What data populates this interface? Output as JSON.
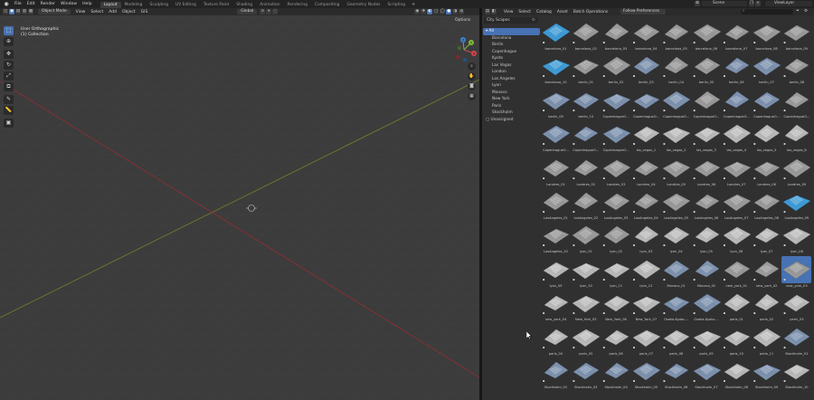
{
  "topbar": {
    "menus": [
      "File",
      "Edit",
      "Render",
      "Window",
      "Help"
    ],
    "workspaces": [
      "Layout",
      "Modeling",
      "Sculpting",
      "UV Editing",
      "Texture Paint",
      "Shading",
      "Animation",
      "Rendering",
      "Compositing",
      "Geometry Nodes",
      "Scripting"
    ],
    "active_workspace": "Layout",
    "add_tab": "+",
    "scene": "Scene",
    "view_layer": "ViewLayer"
  },
  "viewport": {
    "mode": "Object Mode",
    "menus": [
      "View",
      "Select",
      "Add",
      "Object",
      "GIS"
    ],
    "orientation": "Global",
    "info_line1": "User Orthographic",
    "info_line2": "(1) Collection",
    "options_label": "Options",
    "gizmo": {
      "x": "X",
      "y": "Y",
      "z": "Z"
    },
    "colors": {
      "bg": "#3c3c3c",
      "grid": "#444444",
      "x_axis": "#8a2f33",
      "y_axis": "#6f7a2c",
      "accent": "#4772b3"
    }
  },
  "asset_browser": {
    "menus": [
      "View",
      "Select",
      "Catalog",
      "Asset",
      "Batch Operations"
    ],
    "library": "City Scapes",
    "import_method": "Follow Preferences",
    "search_placeholder": "",
    "catalogs": [
      "All",
      "Barcelona",
      "Berlin",
      "Copenhague",
      "Kyoto",
      "Las Vegas",
      "London",
      "Los Angeles",
      "Lyon",
      "Monaco",
      "New York",
      "Paris",
      "Stockholm",
      "Unassigned"
    ],
    "assets": [
      {
        "label": "barcelona_01",
        "tone": "blue"
      },
      {
        "label": "barcelona_02",
        "tone": "gray"
      },
      {
        "label": "barcelona_03",
        "tone": "gray"
      },
      {
        "label": "barcelona_04",
        "tone": "gray"
      },
      {
        "label": "barcelona_05",
        "tone": "gray"
      },
      {
        "label": "barcelona_06",
        "tone": "gray"
      },
      {
        "label": "barcelona_07",
        "tone": "gray"
      },
      {
        "label": "barcelona_08",
        "tone": "gray"
      },
      {
        "label": "barcelona_09",
        "tone": "gray"
      },
      {
        "label": "barcelona_10",
        "tone": "blue"
      },
      {
        "label": "berlin_01",
        "tone": "gray"
      },
      {
        "label": "berlin_02",
        "tone": "gray"
      },
      {
        "label": "berlin_03",
        "tone": "bluegray"
      },
      {
        "label": "berlin_04",
        "tone": "gray"
      },
      {
        "label": "berlin_05",
        "tone": "gray"
      },
      {
        "label": "berlin_06",
        "tone": "bluegray"
      },
      {
        "label": "berlin_07",
        "tone": "bluegray"
      },
      {
        "label": "berlin_08",
        "tone": "gray"
      },
      {
        "label": "berlin_09",
        "tone": "bluegray"
      },
      {
        "label": "berlin_10",
        "tone": "bluegray"
      },
      {
        "label": "CopenhagueO...",
        "tone": "bluegray"
      },
      {
        "label": "CopenhagueO...",
        "tone": "bluegray"
      },
      {
        "label": "CopenhagueO...",
        "tone": "bluegray"
      },
      {
        "label": "CopenhagueO...",
        "tone": "gray"
      },
      {
        "label": "CopenhagueO...",
        "tone": "bluegray"
      },
      {
        "label": "CopenhagueO...",
        "tone": "bluegray"
      },
      {
        "label": "CopenhagueO...",
        "tone": "gray"
      },
      {
        "label": "CopenhagueO...",
        "tone": "bluegray"
      },
      {
        "label": "CopenhagueO...",
        "tone": "bluegray"
      },
      {
        "label": "CopenhagueO...",
        "tone": "bluegray"
      },
      {
        "label": "las_vegas_1",
        "tone": "light"
      },
      {
        "label": "las_vegas_2",
        "tone": "light"
      },
      {
        "label": "las_vegas_3",
        "tone": "light"
      },
      {
        "label": "las_vegas_4",
        "tone": "light"
      },
      {
        "label": "las_vegas_5",
        "tone": "light"
      },
      {
        "label": "las_vegas_6",
        "tone": "light"
      },
      {
        "label": "Londres_01",
        "tone": "gray"
      },
      {
        "label": "Londres_02",
        "tone": "gray"
      },
      {
        "label": "Londres_03",
        "tone": "gray"
      },
      {
        "label": "Londres_04",
        "tone": "gray"
      },
      {
        "label": "Londres_05",
        "tone": "gray"
      },
      {
        "label": "Londres_06",
        "tone": "gray"
      },
      {
        "label": "Londres_07",
        "tone": "gray"
      },
      {
        "label": "Londres_08",
        "tone": "gray"
      },
      {
        "label": "Londres_09",
        "tone": "gray"
      },
      {
        "label": "LosAngeles_01",
        "tone": "gray"
      },
      {
        "label": "LosAngeles_02",
        "tone": "gray"
      },
      {
        "label": "LosAngeles_03",
        "tone": "gray"
      },
      {
        "label": "LosAngeles_04",
        "tone": "gray"
      },
      {
        "label": "LosAngeles_05",
        "tone": "gray"
      },
      {
        "label": "LosAngeles_06",
        "tone": "gray"
      },
      {
        "label": "LosAngeles_07",
        "tone": "gray"
      },
      {
        "label": "LosAngeles_08",
        "tone": "gray"
      },
      {
        "label": "LosAngeles_09",
        "tone": "blue"
      },
      {
        "label": "LosAngeles_10",
        "tone": "gray"
      },
      {
        "label": "lyon_01",
        "tone": "gray"
      },
      {
        "label": "lyon_02",
        "tone": "gray"
      },
      {
        "label": "lyon_03",
        "tone": "light"
      },
      {
        "label": "lyon_04",
        "tone": "light"
      },
      {
        "label": "lyon_05",
        "tone": "light"
      },
      {
        "label": "lyon_06",
        "tone": "light"
      },
      {
        "label": "lyon_07",
        "tone": "light"
      },
      {
        "label": "lyon_08",
        "tone": "light"
      },
      {
        "label": "lyon_09",
        "tone": "light"
      },
      {
        "label": "lyon_10",
        "tone": "light"
      },
      {
        "label": "lyon_11",
        "tone": "light"
      },
      {
        "label": "lyon_12",
        "tone": "light"
      },
      {
        "label": "Monaco_01",
        "tone": "bluegray"
      },
      {
        "label": "Monaco_02",
        "tone": "bluegray"
      },
      {
        "label": "new_york_01",
        "tone": "gray"
      },
      {
        "label": "new_york_02",
        "tone": "gray"
      },
      {
        "label": "new_york_03",
        "tone": "gray"
      },
      {
        "label": "new_york_04",
        "tone": "light"
      },
      {
        "label": "New_York_05",
        "tone": "light"
      },
      {
        "label": "New_York_06",
        "tone": "light"
      },
      {
        "label": "New_York_07",
        "tone": "light"
      },
      {
        "label": "Osaka-Kyoto-...",
        "tone": "bluegray"
      },
      {
        "label": "Osaka-Kyoto-...",
        "tone": "bluegray"
      },
      {
        "label": "paris_01",
        "tone": "light"
      },
      {
        "label": "paris_02",
        "tone": "light"
      },
      {
        "label": "paris_03",
        "tone": "light"
      },
      {
        "label": "paris_04",
        "tone": "light"
      },
      {
        "label": "paris_05",
        "tone": "light"
      },
      {
        "label": "paris_06",
        "tone": "light"
      },
      {
        "label": "paris_07",
        "tone": "light"
      },
      {
        "label": "paris_08",
        "tone": "light"
      },
      {
        "label": "paris_09",
        "tone": "light"
      },
      {
        "label": "paris_10",
        "tone": "light"
      },
      {
        "label": "paris_11",
        "tone": "light"
      },
      {
        "label": "Stockholm_01",
        "tone": "bluegray"
      },
      {
        "label": "Stockholm_02",
        "tone": "bluegray"
      },
      {
        "label": "Stockholm_03",
        "tone": "bluegray"
      },
      {
        "label": "Stockholm_04",
        "tone": "bluegray"
      },
      {
        "label": "Stockholm_05",
        "tone": "bluegray"
      },
      {
        "label": "Stockholm_06",
        "tone": "bluegray"
      },
      {
        "label": "Stockholm_07",
        "tone": "bluegray"
      },
      {
        "label": "Stockholm_08",
        "tone": "light"
      },
      {
        "label": "Stockholm_09",
        "tone": "bluegray"
      },
      {
        "label": "Stockholm_10",
        "tone": "light"
      }
    ],
    "selected_asset": "new_york_03"
  }
}
